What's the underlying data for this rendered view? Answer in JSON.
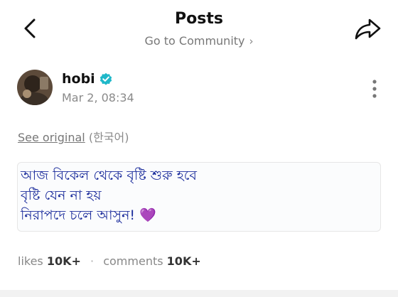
{
  "header": {
    "title": "Posts",
    "subnav": "Go to Community"
  },
  "icons": {
    "back": "chevron-left-icon",
    "share": "share-arrow-icon",
    "more": "vertical-dots-icon",
    "verified": "verified-badge-icon"
  },
  "post": {
    "author": "hobi",
    "timestamp": "Mar 2, 08:34",
    "see_original": "See original",
    "original_lang": "(한국어)",
    "lines": [
      "আজ বিকেল থেকে বৃষ্টি শুরু হবে",
      "বৃষ্টি যেন না হয়",
      "নিরাপদে চলে আসুন! 💜"
    ],
    "likes_label": "likes",
    "likes_count": "10K+",
    "comments_label": "comments",
    "comments_count": "10K+"
  },
  "colors": {
    "verified": "#1fb8c9",
    "translated_text": "#1c2d9c"
  }
}
